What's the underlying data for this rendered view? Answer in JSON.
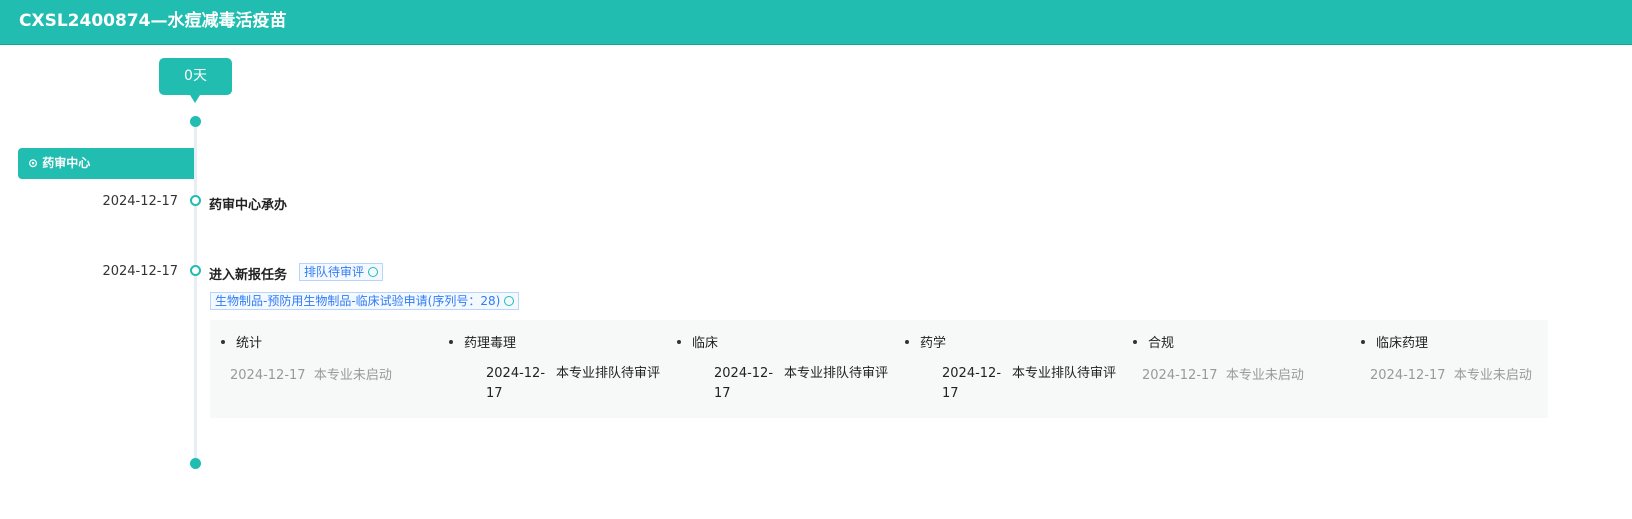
{
  "header": {
    "title": "CXSL2400874—水痘减毒活疫苗"
  },
  "bubble": "0天",
  "location": "药审中心",
  "events": [
    {
      "date": "2024-12-17",
      "title": "药审中心承办"
    },
    {
      "date": "2024-12-17",
      "title": "进入新报任务",
      "status_tag": "排队待审评",
      "category_tag": "生物制品-预防用生物制品-临床试验申请(序列号：28)"
    }
  ],
  "disciplines": [
    {
      "name": "统计",
      "date": "2024-12-17",
      "status": "本专业未启动",
      "active": false
    },
    {
      "name": "药理毒理",
      "date": "2024-12-17",
      "status": "本专业排队待审评",
      "active": true
    },
    {
      "name": "临床",
      "date": "2024-12-17",
      "status": "本专业排队待审评",
      "active": true
    },
    {
      "name": "药学",
      "date": "2024-12-17",
      "status": "本专业排队待审评",
      "active": true
    },
    {
      "name": "合规",
      "date": "2024-12-17",
      "status": "本专业未启动",
      "active": false
    },
    {
      "name": "临床药理",
      "date": "2024-12-17",
      "status": "本专业未启动",
      "active": false
    }
  ]
}
